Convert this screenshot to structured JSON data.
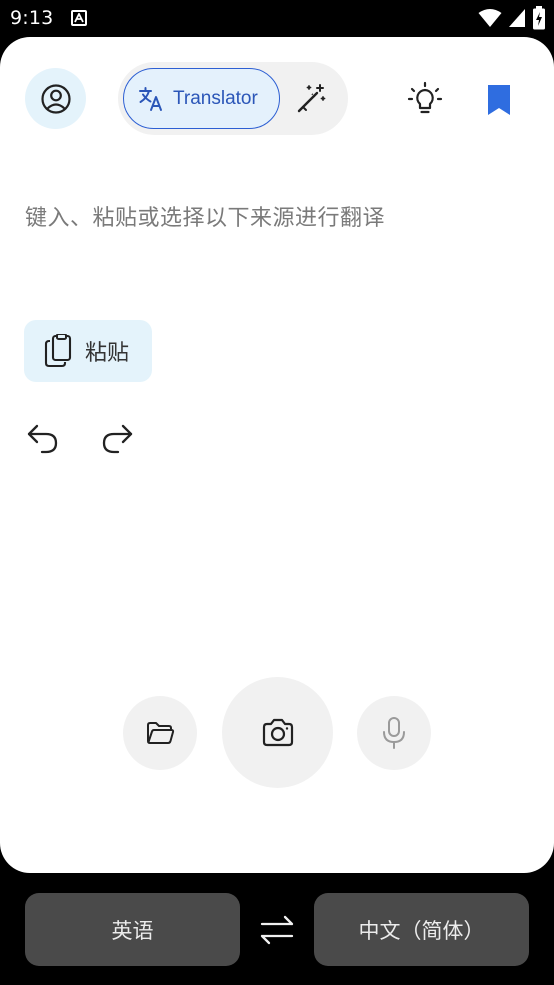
{
  "status_bar": {
    "time": "9:13",
    "icons": [
      "a-notification-icon",
      "wifi-icon",
      "cellular-signal-icon",
      "battery-charging-icon"
    ]
  },
  "header": {
    "mode_translator_label": "Translator",
    "icons": {
      "account": "account-circle-icon",
      "translate": "translate-icon",
      "magic": "magic-wand-icon",
      "bulb": "lightbulb-icon",
      "bookmark": "bookmark-icon"
    }
  },
  "main": {
    "input_placeholder": "键入、粘贴或选择以下来源进行翻译",
    "paste_label": "粘贴",
    "icons": [
      "clipboard-icon",
      "undo-icon",
      "redo-icon",
      "folder-icon",
      "camera-icon",
      "microphone-icon"
    ]
  },
  "languages": {
    "source": "英语",
    "target": "中文（简体）",
    "swap_icon": "swap-arrows-icon"
  },
  "colors": {
    "accent": "#2d5fd3",
    "accent_soft": "#e4f3fb",
    "bookmark": "#2f6de0",
    "lang_button_bg": "#4a4a4a"
  }
}
